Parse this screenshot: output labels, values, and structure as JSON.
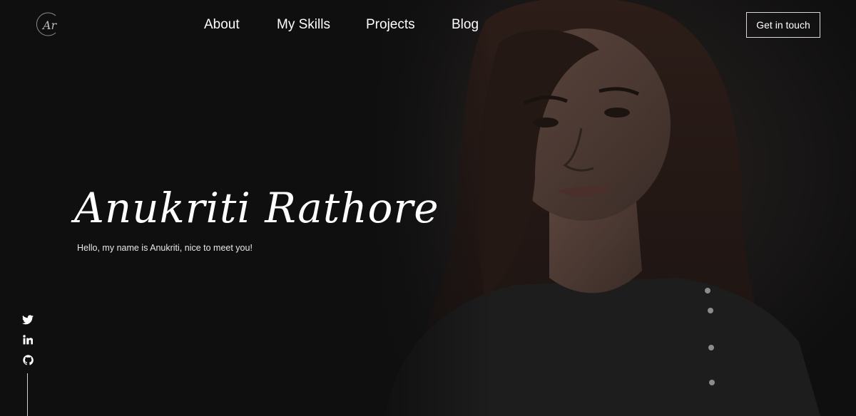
{
  "header": {
    "logo_text": "Ar",
    "logo_icon": "ar-monogram-logo",
    "nav": [
      {
        "label": "About"
      },
      {
        "label": "My Skills"
      },
      {
        "label": "Projects"
      },
      {
        "label": "Blog"
      }
    ],
    "cta_label": "Get in touch"
  },
  "hero": {
    "name": "Anukriti Rathore",
    "tagline": "Hello, my name is Anukriti, nice to meet you!",
    "image_subject": "portrait-photo"
  },
  "social": [
    {
      "icon": "twitter-icon"
    },
    {
      "icon": "linkedin-icon"
    },
    {
      "icon": "github-icon"
    }
  ],
  "colors": {
    "background": "#0f0f10",
    "text": "#ffffff",
    "button_border": "#d9d9d9"
  }
}
